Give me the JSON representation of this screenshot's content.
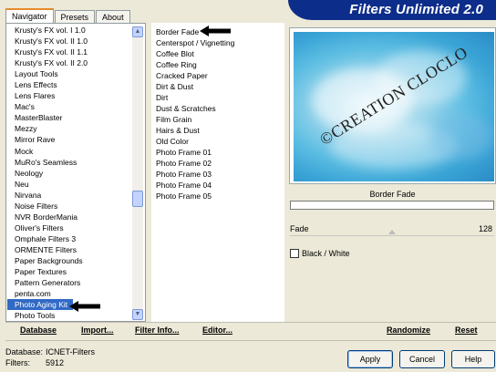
{
  "window": {
    "title": "Filters Unlimited 2.0"
  },
  "tabs": [
    {
      "label": "Navigator"
    },
    {
      "label": "Presets"
    },
    {
      "label": "About"
    }
  ],
  "categories": [
    "Krusty's FX vol. I 1.0",
    "Krusty's FX vol. II 1.0",
    "Krusty's FX vol. II 1.1",
    "Krusty's FX vol. II 2.0",
    "Layout Tools",
    "Lens Effects",
    "Lens Flares",
    "Mac's",
    "MasterBlaster",
    "Mezzy",
    "Mirror Rave",
    "Mock",
    "MuRo's Seamless",
    "Neology",
    "Neu",
    "Nirvana",
    "Noise Filters",
    "NVR BorderMania",
    "Oliver's Filters",
    "Omphale Filters 3",
    "ORMENTE Filters",
    "Paper Backgrounds",
    "Paper Textures",
    "Pattern Generators",
    "penta.com",
    "Photo Aging Kit",
    "Photo Tools"
  ],
  "selected_category": "Photo Aging Kit",
  "filters": [
    "Border Fade",
    "Centerspot / Vignetting",
    "Coffee Blot",
    "Coffee Ring",
    "Cracked Paper",
    "Dirt & Dust",
    "Dirt",
    "Dust & Scratches",
    "Film Grain",
    "Hairs & Dust",
    "Old Color",
    "Photo Frame 01",
    "Photo Frame 02",
    "Photo Frame 03",
    "Photo Frame 04",
    "Photo Frame 05"
  ],
  "preview": {
    "watermark": "©CREATION CLOCLO"
  },
  "filter_panel": {
    "name": "Border Fade",
    "param_label": "Fade",
    "param_value": "128",
    "checkbox_label": "Black / White"
  },
  "toolbar": {
    "database": "Database",
    "import": "Import...",
    "filter_info": "Filter Info...",
    "editor": "Editor...",
    "randomize": "Randomize",
    "reset": "Reset"
  },
  "status": {
    "database_label": "Database:",
    "database_value": "ICNET-Filters",
    "filters_label": "Filters:",
    "filters_value": "5912"
  },
  "buttons": {
    "apply": "Apply",
    "cancel": "Cancel",
    "help": "Help"
  },
  "colors": {
    "banner": "#0d2d8a",
    "selection": "#316ac5",
    "tab_highlight": "#e68b2c"
  }
}
